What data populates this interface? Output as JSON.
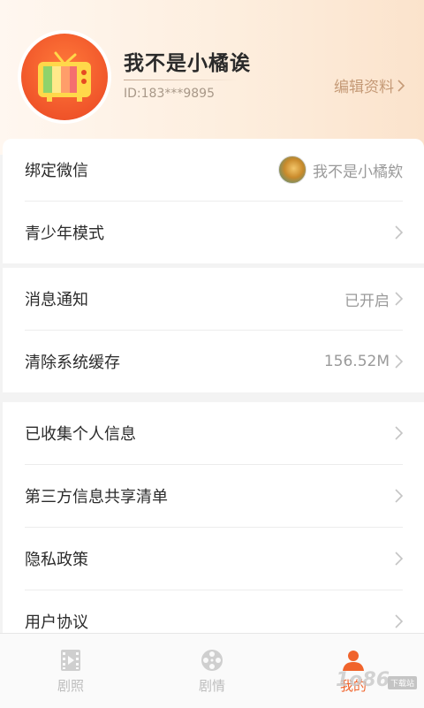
{
  "profile": {
    "username": "我不是小橘诶",
    "user_id": "ID:183***9895",
    "edit_label": "编辑资料",
    "avatar_icon": "tv-icon"
  },
  "section1": [
    {
      "label": "绑定微信",
      "value": "我不是小橘欸",
      "has_avatar": true
    },
    {
      "label": "青少年模式",
      "value": ""
    }
  ],
  "section2": [
    {
      "label": "消息通知",
      "value": "已开启"
    },
    {
      "label": "清除系统缓存",
      "value": "156.52M"
    }
  ],
  "section3": [
    {
      "label": "已收集个人信息"
    },
    {
      "label": "第三方信息共享清单"
    },
    {
      "label": "隐私政策"
    },
    {
      "label": "用户协议"
    }
  ],
  "tabs": [
    {
      "label": "剧照",
      "icon": "film-icon"
    },
    {
      "label": "剧情",
      "icon": "film-reel-icon"
    },
    {
      "label": "我的",
      "icon": "user-icon",
      "active": true
    }
  ],
  "watermark": {
    "text": "1o86",
    "badge": "下载站"
  },
  "colors": {
    "accent": "#f0642c",
    "header_gradient_end": "#fbe3cc",
    "edit_text": "#c59a77"
  }
}
